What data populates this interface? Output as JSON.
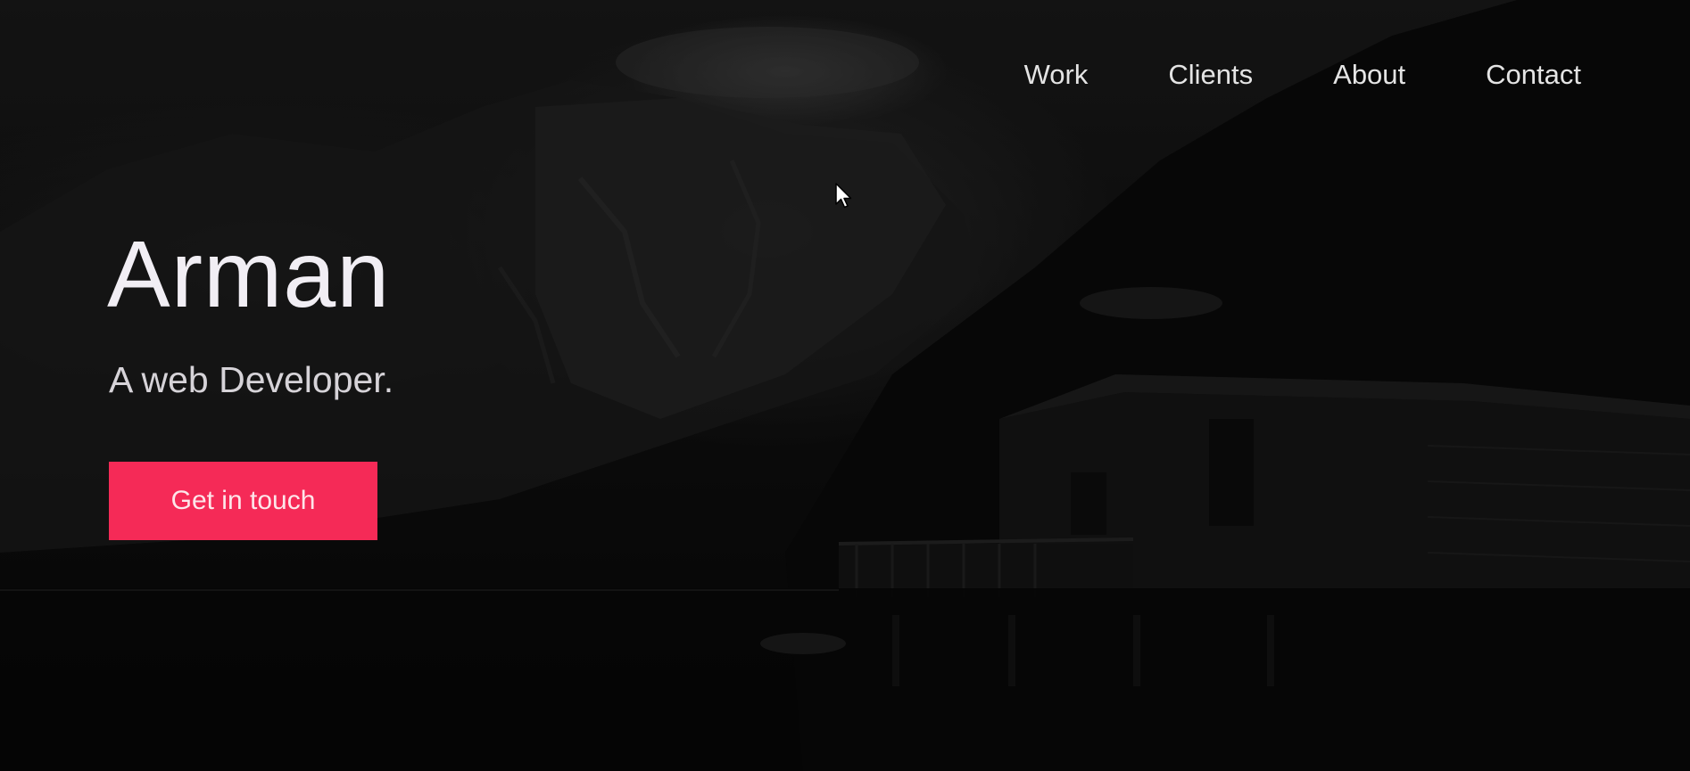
{
  "nav": {
    "items": [
      {
        "label": "Work"
      },
      {
        "label": "Clients"
      },
      {
        "label": "About"
      },
      {
        "label": "Contact"
      }
    ]
  },
  "hero": {
    "name": "Arman",
    "tagline": "A web Developer.",
    "cta_label": "Get in touch"
  },
  "colors": {
    "accent": "#f52a57",
    "background": "#0b0b0b",
    "text": "#f1eef4"
  },
  "icons": {
    "cursor": "mouse-pointer-icon"
  }
}
